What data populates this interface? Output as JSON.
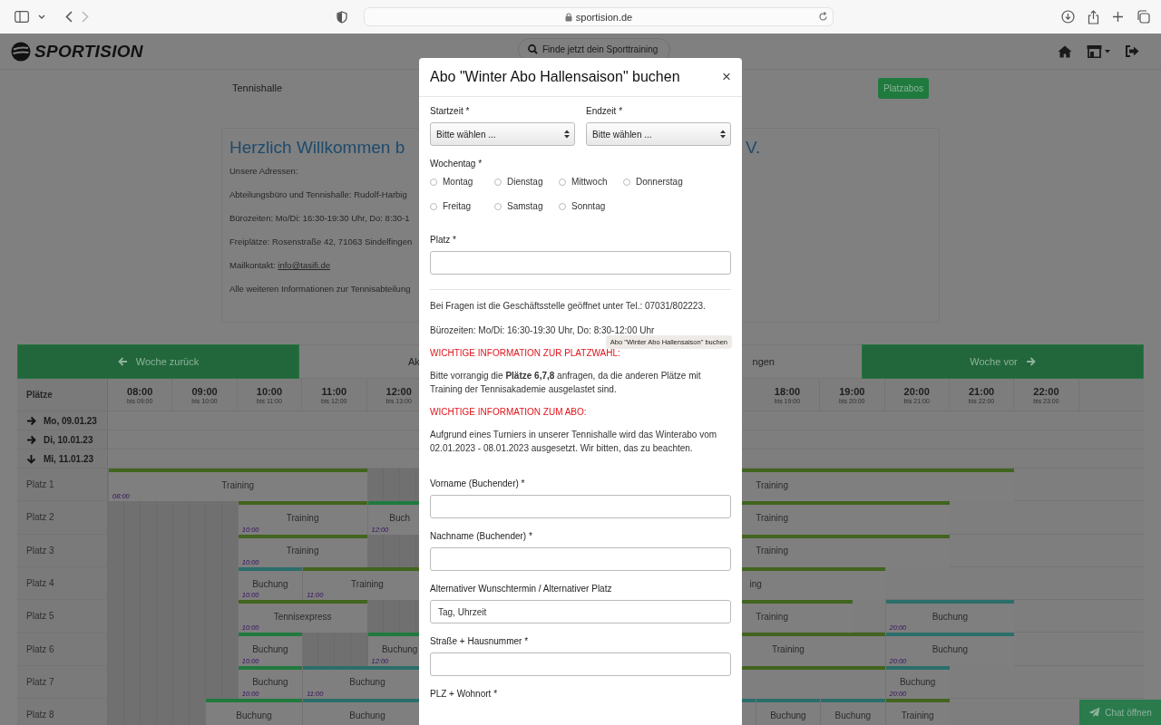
{
  "browser": {
    "url": "sportision.de"
  },
  "header": {
    "logo": "SPORTISION",
    "search": "Finde jetzt dein Sporttraining"
  },
  "subbar": {
    "title": "Tennishalle",
    "button": "Platzabos"
  },
  "welcome": {
    "heading": "Herzlich Willkommen b",
    "heading_end": "V.",
    "lines": [
      {
        "text": "Unsere Adressen:"
      },
      {
        "text": "Abteilungsbüro und Tennishalle: Rudolf-Harbig"
      },
      {
        "text": "Bürozeiten: Mo/Di: 16:30-19:30 Uhr, Do: 8:30-1"
      },
      {
        "text": "Freiplätze: Rosenstraße 42, 71063 Sindelfingen"
      },
      {
        "text": "Mailkontakt:",
        "link": "info@tasifi.de"
      },
      {
        "text": "Alle weiteren Informationen zur Tennisabteilung"
      }
    ]
  },
  "week_nav": {
    "prev": "Woche zurück",
    "middle_left": "Ak",
    "middle_right": "ngen",
    "next": "Woche vor"
  },
  "schedule": {
    "corner": "Plätze",
    "hours": [
      {
        "time": "08:00",
        "until": "bis 09:00"
      },
      {
        "time": "09:00",
        "until": "bis 10:00"
      },
      {
        "time": "10:00",
        "until": "bis 11:00"
      },
      {
        "time": "11:00",
        "until": "bis 12:00"
      },
      {
        "time": "12:00",
        "until": "bis 13:00"
      },
      {
        "time": "18:00",
        "until": "bis 19:00"
      },
      {
        "time": "19:00",
        "until": "bis 20:00"
      },
      {
        "time": "20:00",
        "until": "bis 21:00"
      },
      {
        "time": "21:00",
        "until": "bis 22:00"
      },
      {
        "time": "22:00",
        "until": "bis 23:00"
      }
    ],
    "days": [
      {
        "label": "Mo, 09.01.23",
        "expanded": false
      },
      {
        "label": "Di, 10.01.23",
        "expanded": false
      },
      {
        "label": "Mi, 11.01.23",
        "expanded": true
      }
    ],
    "courts": [
      {
        "name": "Platz 1",
        "blocks": [
          {
            "kind": "slot",
            "label": "Training",
            "time": "08:00",
            "color": "#41641e"
          },
          {
            "kind": "blocked"
          },
          {
            "kind": "slot",
            "label": "Training",
            "color": "#41641e"
          }
        ]
      },
      {
        "name": "Platz 2",
        "blocks": [
          {
            "kind": "blocked"
          },
          {
            "kind": "slot",
            "label": "Training",
            "time": "10:00",
            "color": "#41641e"
          },
          {
            "kind": "slot",
            "label": "Buch",
            "time": "12:00",
            "color": "#1f7a3e"
          },
          {
            "kind": "slot",
            "label": "Training",
            "color": "#41641e"
          }
        ]
      },
      {
        "name": "Platz 3",
        "blocks": [
          {
            "kind": "blocked"
          },
          {
            "kind": "slot",
            "label": "Training",
            "time": "10:00",
            "color": "#41641e"
          },
          {
            "kind": "blocked"
          },
          {
            "kind": "slot",
            "label": "Training",
            "color": "#41641e"
          }
        ]
      },
      {
        "name": "Platz 4",
        "blocks": [
          {
            "kind": "blocked"
          },
          {
            "kind": "slot",
            "label": "Buchung",
            "time": "10:00",
            "color": "#2b6e6a"
          },
          {
            "kind": "slot",
            "label": "Training",
            "time": "11:00",
            "color": "#41641e"
          },
          {
            "kind": "slot",
            "label": "ing",
            "color": "#41641e"
          }
        ]
      },
      {
        "name": "Platz 5",
        "blocks": [
          {
            "kind": "blocked"
          },
          {
            "kind": "slot",
            "label": "Tennisexpress",
            "time": "10:00",
            "color": "#41641e"
          },
          {
            "kind": "blocked"
          },
          {
            "kind": "slot",
            "label": "Training",
            "color": "#41641e"
          },
          {
            "kind": "slot",
            "label": "Buchung",
            "time": "20:00",
            "color": "#2b6e6a"
          }
        ]
      },
      {
        "name": "Platz 6",
        "blocks": [
          {
            "kind": "blocked"
          },
          {
            "kind": "slot",
            "label": "Buchung",
            "time": "10:00",
            "color": "#1f7a3e"
          },
          {
            "kind": "blocked"
          },
          {
            "kind": "slot",
            "label": "Buchung",
            "time": "12:00",
            "color": "#1f7a3e"
          },
          {
            "kind": "slot",
            "label": "Training",
            "color": "#41641e"
          },
          {
            "kind": "slot",
            "label": "Buchung",
            "time": "20:00",
            "color": "#2b6e6a"
          }
        ]
      },
      {
        "name": "Platz 7",
        "blocks": [
          {
            "kind": "blocked"
          },
          {
            "kind": "slot",
            "label": "Buchung",
            "time": "10:00",
            "color": "#1f7a3e"
          },
          {
            "kind": "slot",
            "label": "Buchung",
            "time": "11:00",
            "color": "#2b6e6a"
          },
          {
            "kind": "slot",
            "color": "#41641e"
          },
          {
            "kind": "slot",
            "label": "Buchung",
            "time": "20:00",
            "color": "#2b6e6a"
          }
        ]
      },
      {
        "name": "Platz 8",
        "blocks": [
          {
            "kind": "blocked"
          },
          {
            "kind": "slot",
            "label": "Buchung",
            "color": "#1f7a3e"
          },
          {
            "kind": "slot",
            "label": "Buchung",
            "color": "#2b6e6a"
          },
          {
            "kind": "slot",
            "color": "#2b6e6a"
          },
          {
            "kind": "slot",
            "label": "Buchung",
            "color": "#2b6e6a"
          },
          {
            "kind": "slot",
            "label": "Buchung",
            "color": "#2b6e6a"
          },
          {
            "kind": "slot",
            "label": "Training",
            "color": "#41641e"
          }
        ]
      }
    ]
  },
  "modal": {
    "title": "Abo \"Winter Abo Hallensaison\" buchen",
    "close": "×",
    "time_fields": [
      {
        "label": "Startzeit *",
        "value": "Bitte wählen ..."
      },
      {
        "label": "Endzeit *",
        "value": "Bitte wählen ..."
      }
    ],
    "weekday": {
      "label": "Wochentag *",
      "options": [
        {
          "label": "Montag",
          "selected": false
        },
        {
          "label": "Dienstag",
          "selected": false
        },
        {
          "label": "Mittwoch",
          "selected": false
        },
        {
          "label": "Donnerstag",
          "selected": false
        },
        {
          "label": "Freitag",
          "selected": false
        },
        {
          "label": "Samstag",
          "selected": false
        },
        {
          "label": "Sonntag",
          "selected": false
        }
      ]
    },
    "court_field": {
      "label": "Platz *"
    },
    "info": [
      {
        "kind": "text",
        "text": "Bei Fragen ist die Geschäftsstelle geöffnet unter Tel.: 07031/802223."
      },
      {
        "kind": "text",
        "text": "Bürozeiten: Mo/Di: 16:30-19:30 Uhr, Do: 8:30-12:00 Uhr",
        "tooltip": "Abo \"Winter Abo Hallensaison\" buchen"
      },
      {
        "kind": "warning",
        "text": "WICHTIGE INFORMATION ZUR PLATZWAHL:"
      },
      {
        "kind": "text",
        "text": "Bitte vorrangig die **Plätze 6,7,8** anfragen, da die anderen Plätze mit Training der Tennisakademie ausgelastet sind."
      },
      {
        "kind": "warning",
        "text": "WICHTIGE INFORMATION ZUM ABO:"
      },
      {
        "kind": "text",
        "text": "Aufgrund eines Turniers in unserer Tennishalle wird das Winterabo vom 02.01.2023 - 08.01.2023 ausgesetzt. Wir bitten, das zu beachten."
      }
    ],
    "fields": [
      {
        "kind": "input",
        "label": "Vorname (Buchender) *"
      },
      {
        "kind": "input",
        "label": "Nachname (Buchender) *"
      },
      {
        "kind": "input",
        "label": "Alternativer Wunschtermin / Alternativer Platz",
        "placeholder": "Tag, Uhrzeit"
      },
      {
        "kind": "input",
        "label": "Straße + Hausnummer *"
      },
      {
        "kind": "label",
        "label": "PLZ + Wohnort *"
      }
    ]
  },
  "chat_button": "Chat öffnen"
}
